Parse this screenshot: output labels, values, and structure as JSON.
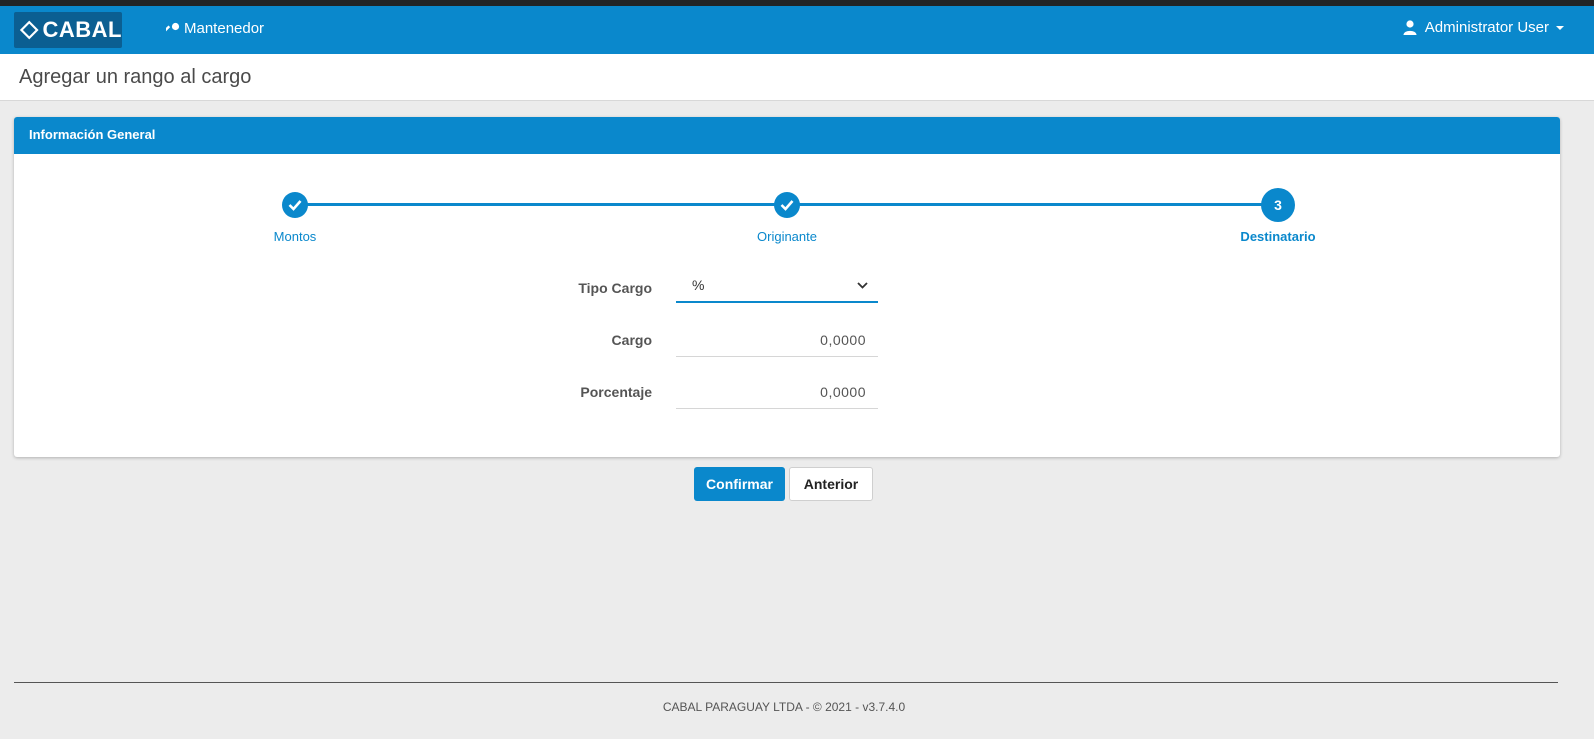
{
  "brand": {
    "name": "CABAL",
    "logo_icon": "cabal-diamond-logo",
    "primary_color": "#0a88cc",
    "logo_bg_color": "#0b5f92"
  },
  "nav": {
    "items": [
      {
        "label": "Mantenedor",
        "icon": "key-icon"
      }
    ],
    "user": {
      "label": "Administrator User",
      "icon": "user-icon"
    }
  },
  "page": {
    "title": "Agregar un rango al cargo"
  },
  "panel": {
    "title": "Información General"
  },
  "wizard": {
    "steps": [
      {
        "label": "Montos",
        "state": "completed",
        "icon": "check-icon"
      },
      {
        "label": "Originante",
        "state": "completed",
        "icon": "check-icon"
      },
      {
        "label": "Destinatario",
        "state": "active",
        "number": "3"
      }
    ]
  },
  "form": {
    "tipo_cargo": {
      "label": "Tipo Cargo",
      "value": "%"
    },
    "cargo": {
      "label": "Cargo",
      "value": "0,0000"
    },
    "porcentaje": {
      "label": "Porcentaje",
      "value": "0,0000"
    }
  },
  "actions": {
    "confirm_label": "Confirmar",
    "previous_label": "Anterior"
  },
  "footer": {
    "text": "CABAL PARAGUAY LTDA - © 2021 - v3.7.4.0"
  }
}
